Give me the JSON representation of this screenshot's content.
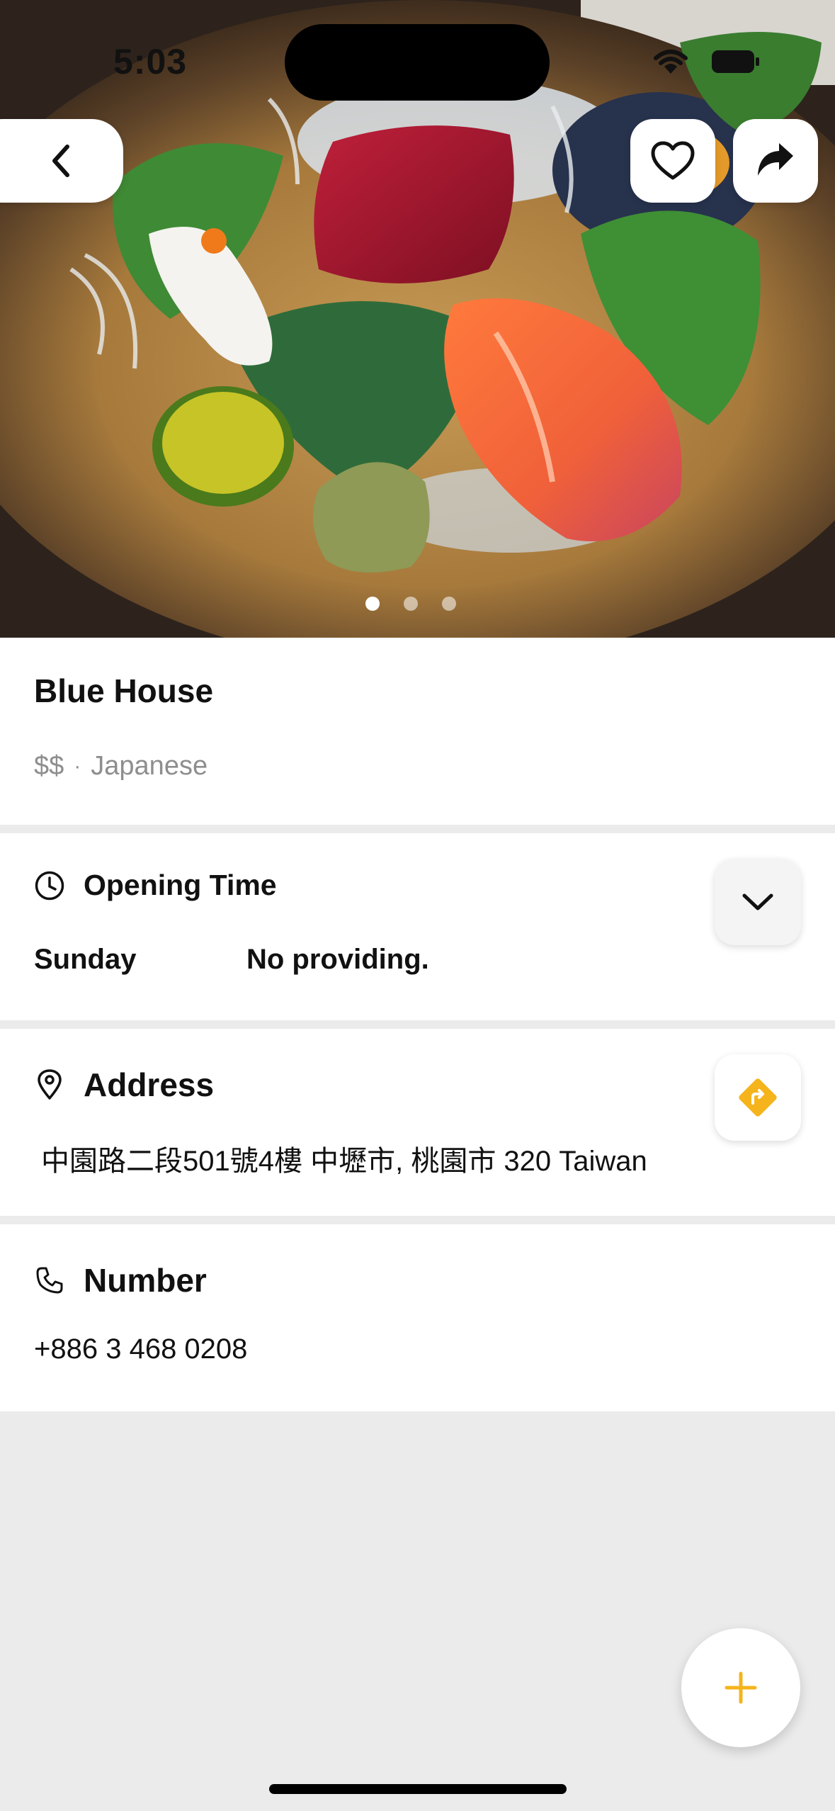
{
  "status_bar": {
    "time": "5:03"
  },
  "hero": {
    "photo_count": 3,
    "active_index": 0
  },
  "place": {
    "name": "Blue House",
    "price": "$$",
    "separator": "·",
    "cuisine": "Japanese"
  },
  "hours": {
    "title": "Opening Time",
    "day": "Sunday",
    "value": "No providing."
  },
  "address": {
    "title": "Address",
    "value": "中園路二段501號4樓 中壢市, 桃園市 320 Taiwan"
  },
  "phone": {
    "title": "Number",
    "value": "+886 3 468 0208"
  },
  "colors": {
    "accent": "#f5b41c",
    "background": "#ebebeb",
    "muted": "#8e8e8e"
  },
  "icons": {
    "back": "chevron-left-icon",
    "favorite": "heart-icon",
    "share": "share-arrow-icon",
    "clock": "clock-icon",
    "expand": "chevron-down-icon",
    "location": "map-pin-icon",
    "directions": "directions-icon",
    "phone": "phone-icon",
    "add": "plus-icon"
  }
}
